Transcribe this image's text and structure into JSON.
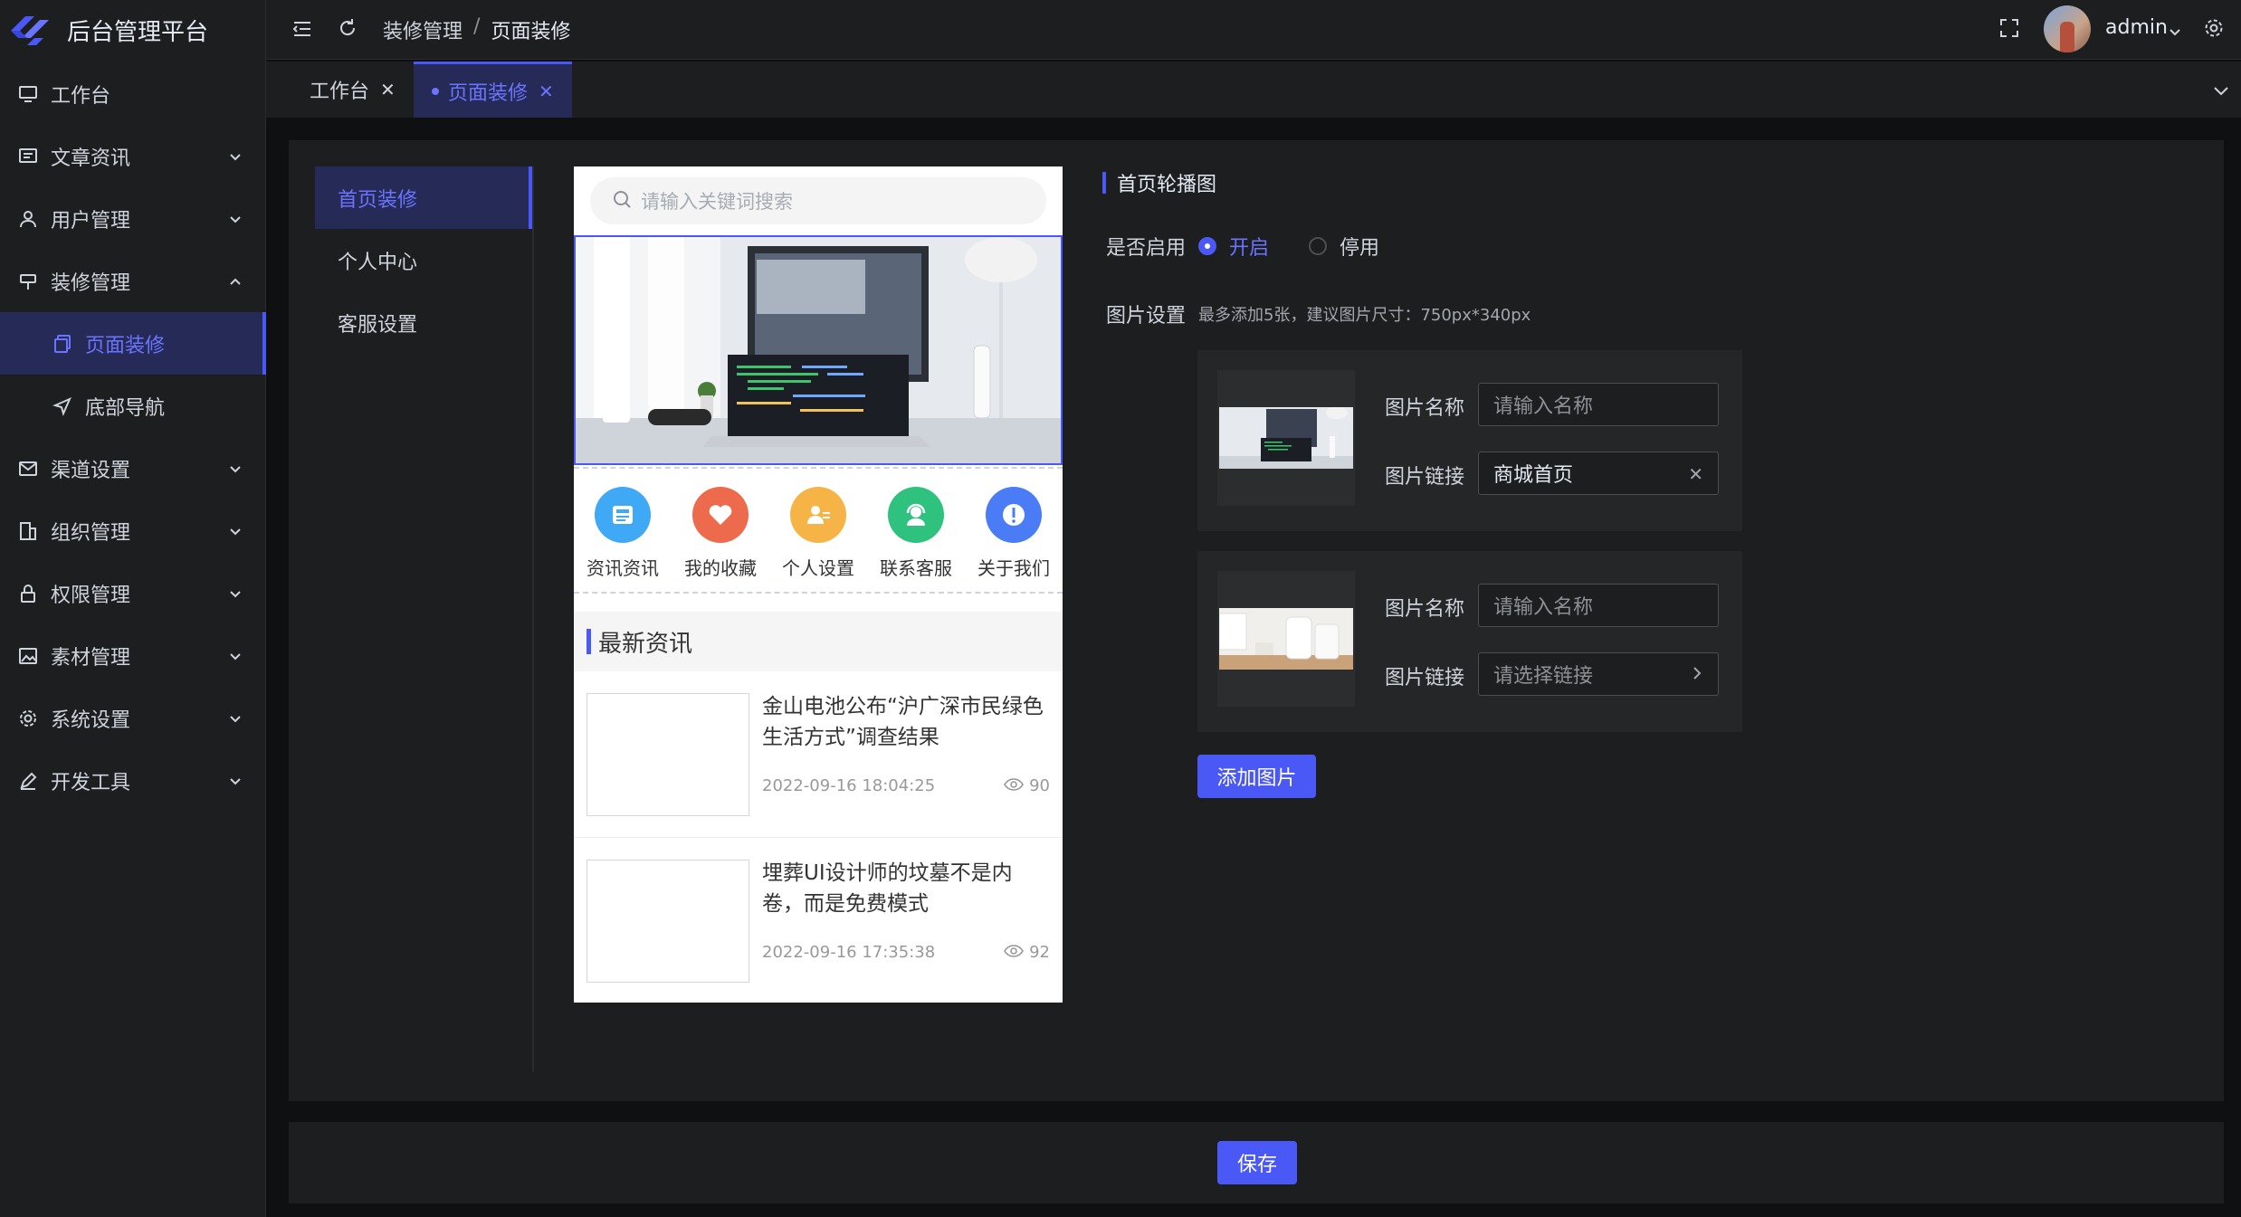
{
  "app": {
    "title": "后台管理平台"
  },
  "sidebar": {
    "items": [
      {
        "label": "工作台"
      },
      {
        "label": "文章资讯"
      },
      {
        "label": "用户管理"
      },
      {
        "label": "装修管理"
      },
      {
        "label": "页面装修"
      },
      {
        "label": "底部导航"
      },
      {
        "label": "渠道设置"
      },
      {
        "label": "组织管理"
      },
      {
        "label": "权限管理"
      },
      {
        "label": "素材管理"
      },
      {
        "label": "系统设置"
      },
      {
        "label": "开发工具"
      }
    ]
  },
  "header": {
    "breadcrumb_parent": "装修管理",
    "breadcrumb_sep": "/",
    "breadcrumb_current": "页面装修",
    "user": "admin"
  },
  "tabs": [
    {
      "label": "工作台"
    },
    {
      "label": "页面装修"
    }
  ],
  "subnav": [
    "首页装修",
    "个人中心",
    "客服设置"
  ],
  "phone": {
    "search_placeholder": "请输入关键词搜索",
    "nav": [
      "资讯资讯",
      "我的收藏",
      "个人设置",
      "联系客服",
      "关于我们"
    ],
    "news_title": "最新资讯",
    "news": [
      {
        "title": "金山电池公布“沪广深市民绿色生活方式”调查结果",
        "date": "2022-09-16 18:04:25",
        "views": "90"
      },
      {
        "title": "埋葬UI设计师的坟墓不是内卷，而是免费模式",
        "date": "2022-09-16 17:35:38",
        "views": "92"
      }
    ]
  },
  "settings": {
    "section_title": "首页轮播图",
    "enable_label": "是否启用",
    "enable_on": "开启",
    "enable_off": "停用",
    "image_label": "图片设置",
    "image_hint": "最多添加5张，建议图片尺寸：750px*340px",
    "cards": [
      {
        "name_label": "图片名称",
        "name_placeholder": "请输入名称",
        "link_label": "图片链接",
        "link_value": "商城首页"
      },
      {
        "name_label": "图片名称",
        "name_placeholder": "请输入名称",
        "link_label": "图片链接",
        "link_placeholder": "请选择链接"
      }
    ],
    "add_button": "添加图片",
    "save_button": "保存"
  },
  "colors": {
    "accent": "#4a58f5",
    "bg": "#0f1012",
    "panel": "#1d1e1f"
  }
}
